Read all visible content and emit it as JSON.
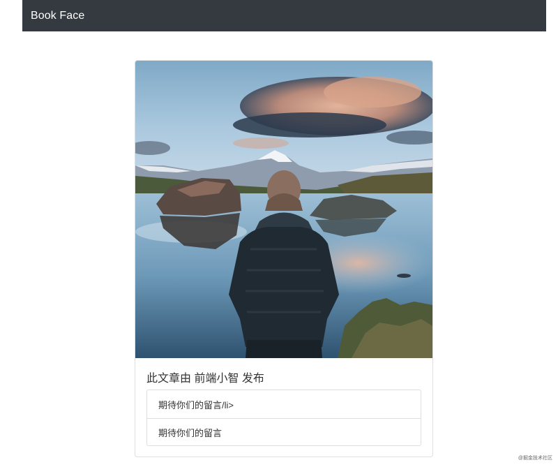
{
  "navbar": {
    "brand": "Book Face"
  },
  "card": {
    "title": "此文章由 前端小智 发布",
    "list_items": [
      "期待你们的留言/li>",
      "期待你们的留言"
    ]
  },
  "watermark": "@掘金技术社区",
  "colors": {
    "navbar_bg": "#343a40",
    "brand_text": "#ffffff",
    "card_border": "#dfdfdf"
  }
}
